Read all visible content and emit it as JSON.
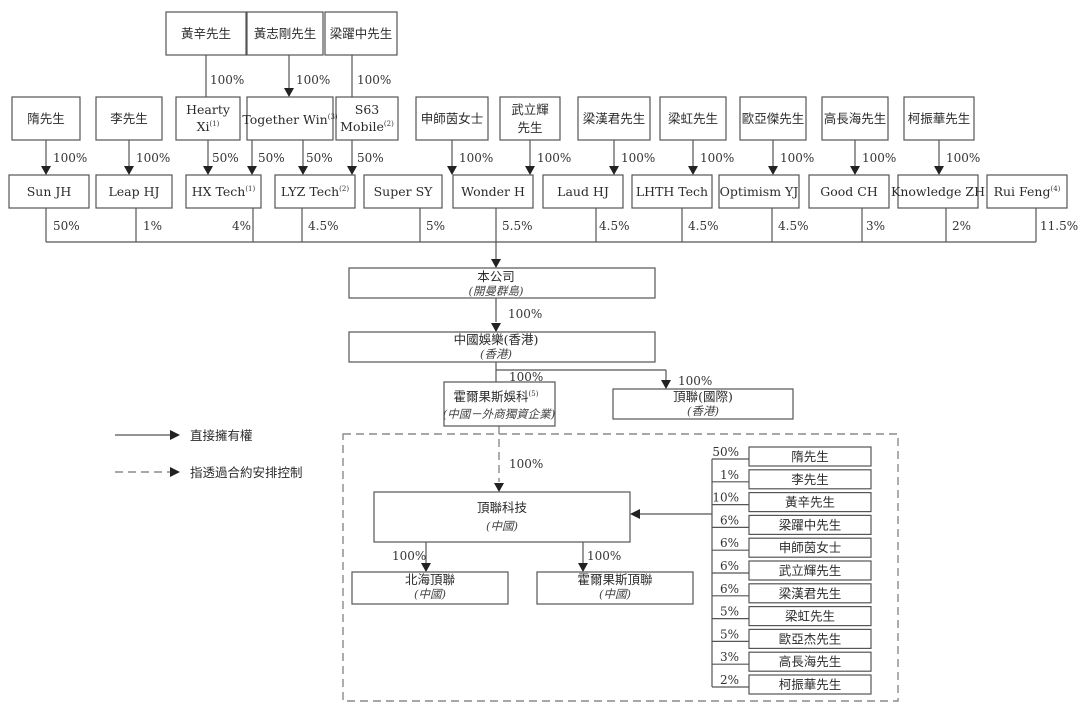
{
  "legend": {
    "direct": "直接擁有權",
    "contractual": "指透過合約安排控制"
  },
  "top_owners": [
    {
      "id": "huangxin",
      "name": "黃辛先生",
      "pct": "100%"
    },
    {
      "id": "huangzhigang",
      "name": "黃志剛先生",
      "pct": "100%"
    },
    {
      "id": "liangyaozhong",
      "name": "梁躍中先生",
      "pct": "100%"
    }
  ],
  "owners": [
    {
      "id": "sui",
      "name": "隋先生",
      "pct": "100%"
    },
    {
      "id": "li",
      "name": "李先生",
      "pct": "100%"
    },
    {
      "id": "shen",
      "name": "申師茵女士",
      "pct": "100%"
    },
    {
      "id": "wu",
      "name": "武立輝先生",
      "pct": "100%"
    },
    {
      "id": "lhj",
      "name": "梁漢君先生",
      "pct": "100%"
    },
    {
      "id": "lh",
      "name": "梁虹先生",
      "pct": "100%"
    },
    {
      "id": "ou",
      "name": "歐亞傑先生",
      "pct": "100%"
    },
    {
      "id": "gao",
      "name": "高長海先生",
      "pct": "100%"
    },
    {
      "id": "ke",
      "name": "柯振華先生",
      "pct": "100%"
    }
  ],
  "holdcos": [
    {
      "id": "hearty",
      "name": "Hearty Xi",
      "note": "(1)",
      "pct_to_hx": "50%"
    },
    {
      "id": "together",
      "name": "Together Win",
      "note": "(3)",
      "pct_to_hx": "50%",
      "pct_to_lyz": "50%"
    },
    {
      "id": "s63",
      "name": "S63 Mobile",
      "note": "(2)",
      "pct_to_lyz": "50%"
    }
  ],
  "shareholders": [
    {
      "id": "sunjh",
      "name": "Sun JH",
      "note": "",
      "pct": "50%"
    },
    {
      "id": "leaphj",
      "name": "Leap HJ",
      "note": "",
      "pct": "1%"
    },
    {
      "id": "hxtech",
      "name": "HX Tech",
      "note": "(1)",
      "pct": "4%"
    },
    {
      "id": "lyztech",
      "name": "LYZ Tech",
      "note": "(2)",
      "pct": "4.5%"
    },
    {
      "id": "supersy",
      "name": "Super SY",
      "note": "",
      "pct": "5%"
    },
    {
      "id": "wonderh",
      "name": "Wonder H",
      "note": "",
      "pct": "5.5%"
    },
    {
      "id": "laudhj",
      "name": "Laud HJ",
      "note": "",
      "pct": "4.5%"
    },
    {
      "id": "lhth",
      "name": "LHTH Tech",
      "note": "",
      "pct": "4.5%"
    },
    {
      "id": "optimism",
      "name": "Optimism YJ",
      "note": "",
      "pct": "4.5%"
    },
    {
      "id": "goodch",
      "name": "Good CH",
      "note": "",
      "pct": "3%"
    },
    {
      "id": "knowledge",
      "name": "Knowledge ZH",
      "note": "",
      "pct": "2%"
    },
    {
      "id": "ruifeng",
      "name": "Rui Feng",
      "note": "(4)",
      "pct": "11.5%"
    }
  ],
  "company": {
    "name": "本公司",
    "place": "(開曼群島)",
    "pct_down": "100%"
  },
  "hk_sub": {
    "name": "中國娛樂(香港)",
    "place": "(香港)"
  },
  "wfoe": {
    "name": "霍爾果斯娛科",
    "note": "(5)",
    "place": "(中國－外商獨資企業)",
    "pct": "100%",
    "pct_vie": "100%"
  },
  "intl": {
    "name": "頂聯(國際)",
    "place": "(香港)",
    "pct": "100%"
  },
  "opco": {
    "name": "頂聯科技",
    "place": "(中國)"
  },
  "opco_subs": [
    {
      "id": "beihai",
      "name": "北海頂聯",
      "place": "(中國)",
      "pct": "100%"
    },
    {
      "id": "khorgos",
      "name": "霍爾果斯頂聯",
      "place": "(中國)",
      "pct": "100%"
    }
  ],
  "registered_holders": [
    {
      "name": "隋先生",
      "pct": "50%"
    },
    {
      "name": "李先生",
      "pct": "1%"
    },
    {
      "name": "黃辛先生",
      "pct": "10%"
    },
    {
      "name": "梁躍中先生",
      "pct": "6%"
    },
    {
      "name": "申師茵女士",
      "pct": "6%"
    },
    {
      "name": "武立輝先生",
      "pct": "6%"
    },
    {
      "name": "梁漢君先生",
      "pct": "6%"
    },
    {
      "name": "梁虹先生",
      "pct": "5%"
    },
    {
      "name": "歐亞杰先生",
      "pct": "5%"
    },
    {
      "name": "高長海先生",
      "pct": "3%"
    },
    {
      "name": "柯振華先生",
      "pct": "2%"
    }
  ]
}
